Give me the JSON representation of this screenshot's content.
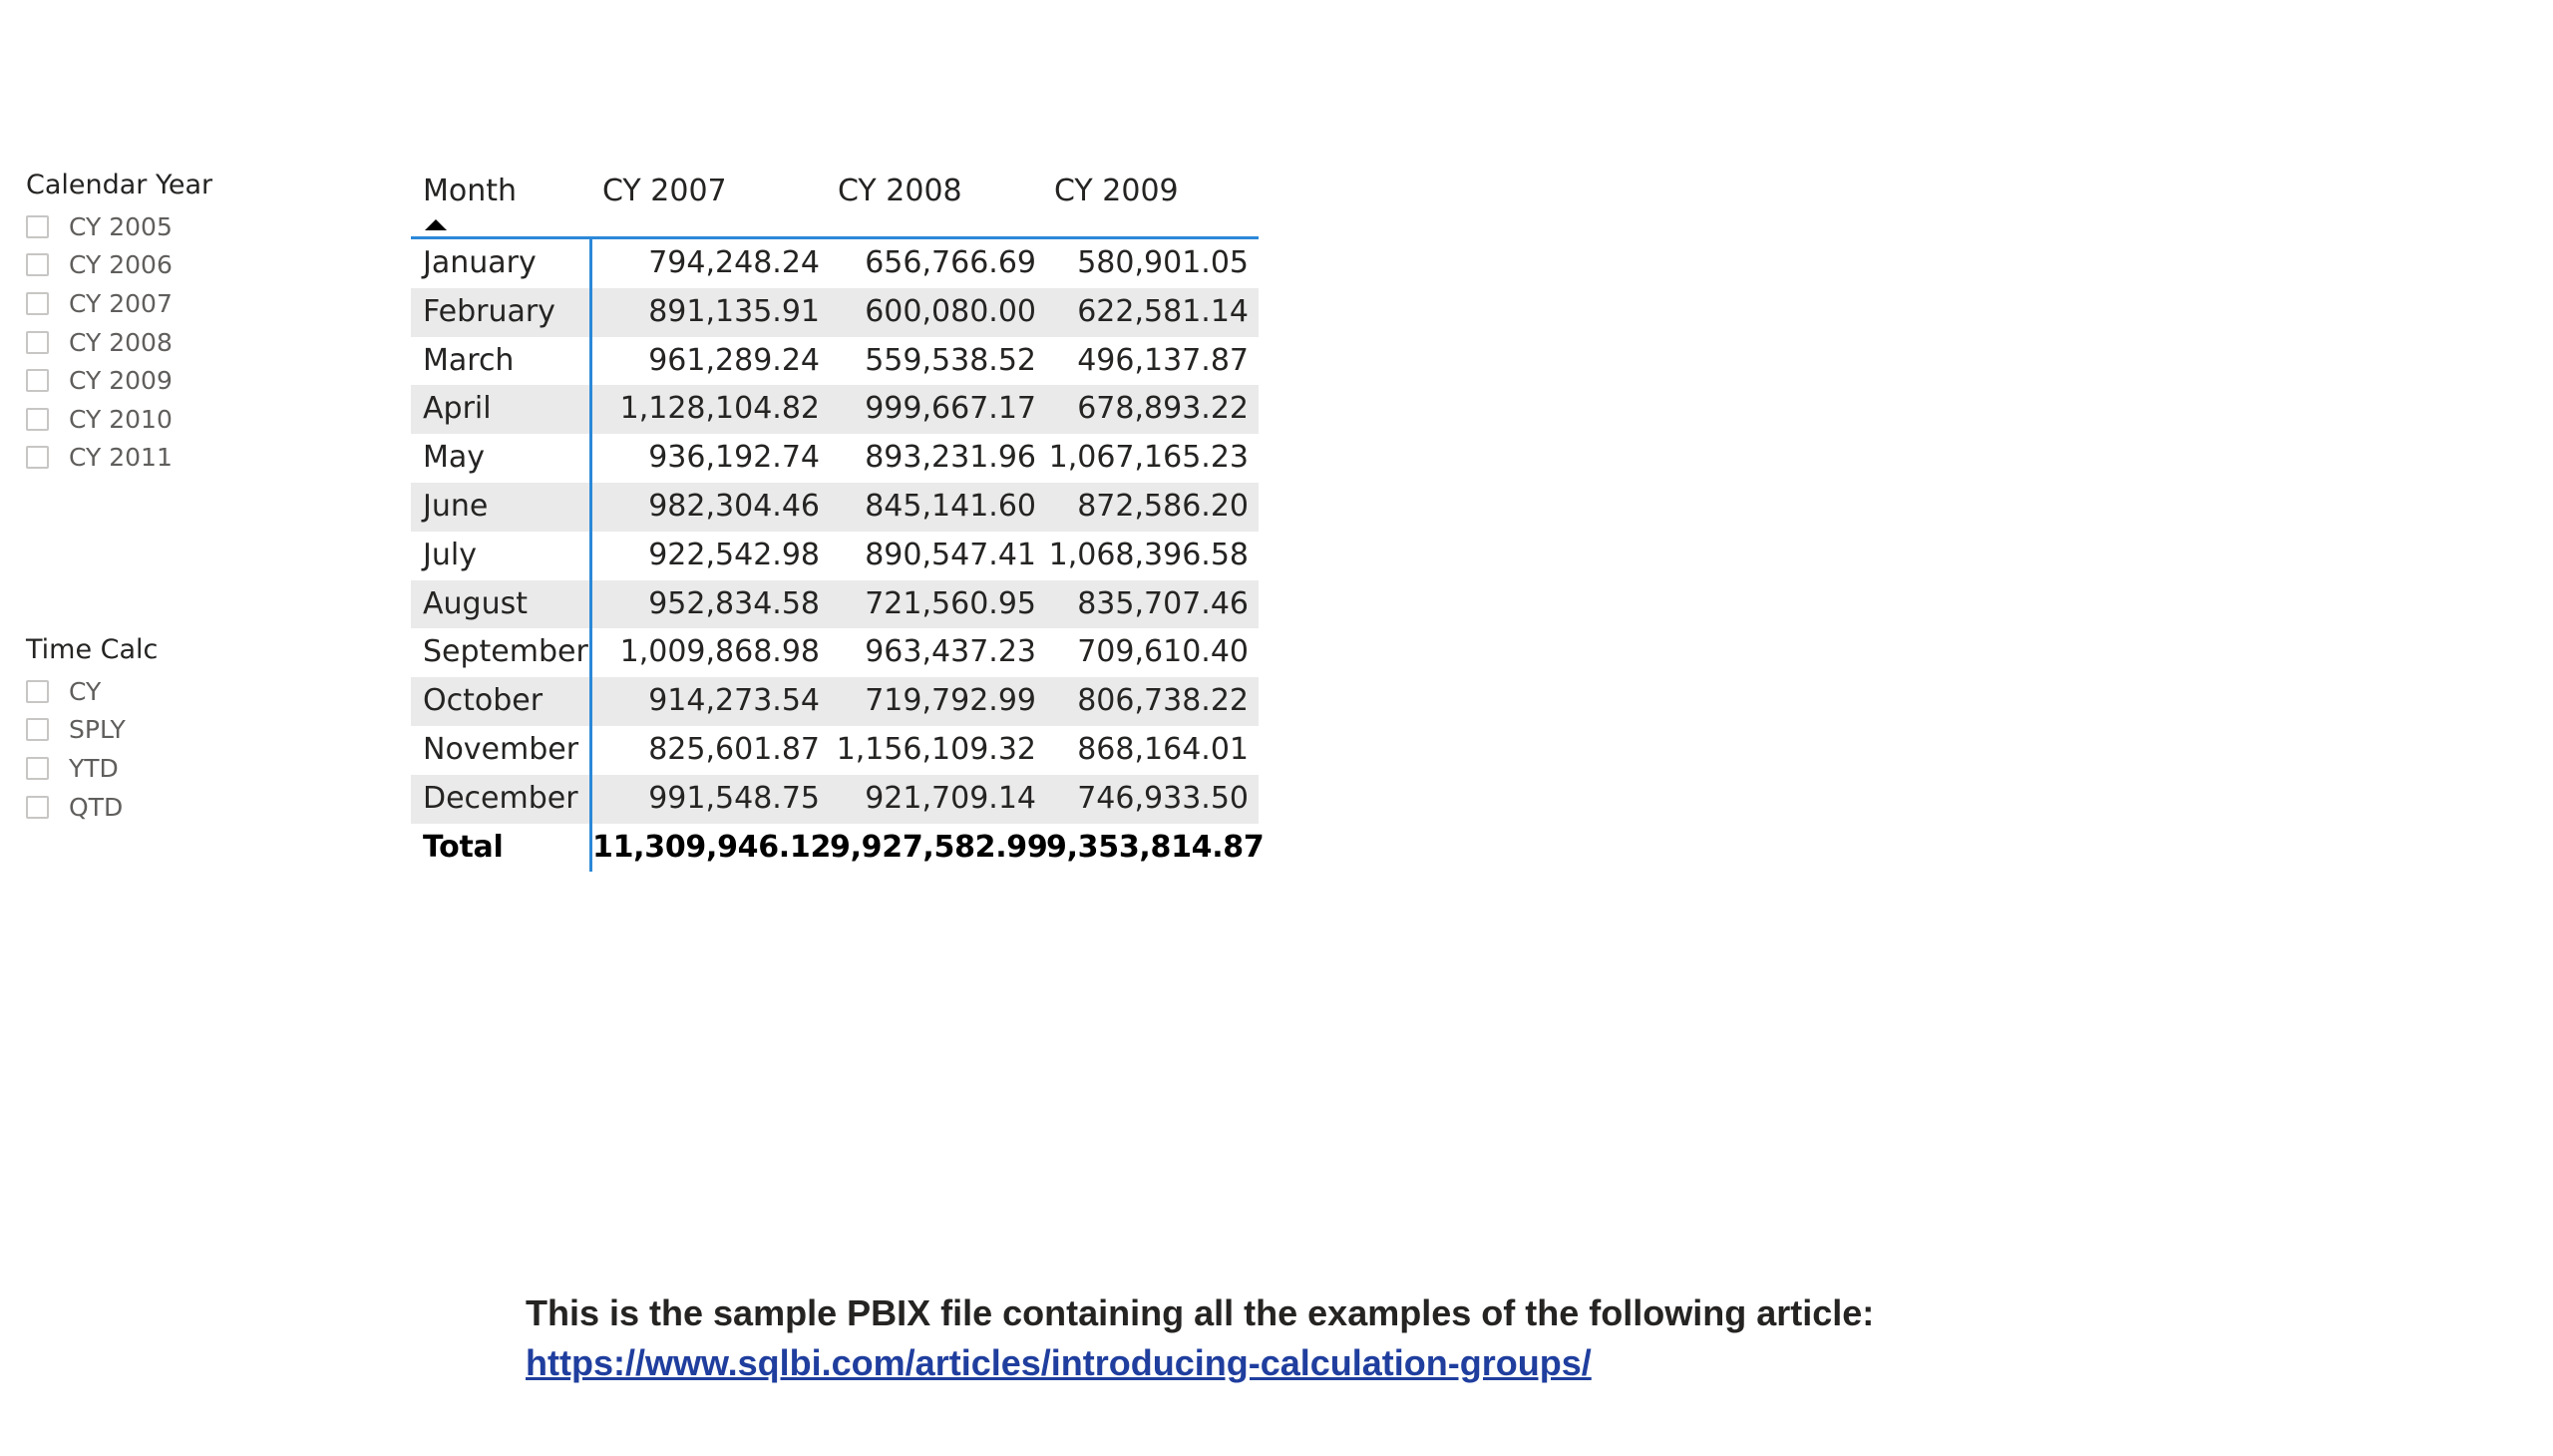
{
  "slicers": {
    "calendar_year": {
      "title": "Calendar Year",
      "items": [
        "CY 2005",
        "CY 2006",
        "CY 2007",
        "CY 2008",
        "CY 2009",
        "CY 2010",
        "CY 2011"
      ]
    },
    "time_calc": {
      "title": "Time Calc",
      "items": [
        "CY",
        "SPLY",
        "YTD",
        "QTD"
      ]
    }
  },
  "matrix": {
    "headers": [
      "Month",
      "CY 2007",
      "CY 2008",
      "CY 2009"
    ],
    "sort_indicator": "sort-ascending",
    "rows": [
      {
        "month": "January",
        "values": [
          "794,248.24",
          "656,766.69",
          "580,901.05"
        ]
      },
      {
        "month": "February",
        "values": [
          "891,135.91",
          "600,080.00",
          "622,581.14"
        ]
      },
      {
        "month": "March",
        "values": [
          "961,289.24",
          "559,538.52",
          "496,137.87"
        ]
      },
      {
        "month": "April",
        "values": [
          "1,128,104.82",
          "999,667.17",
          "678,893.22"
        ]
      },
      {
        "month": "May",
        "values": [
          "936,192.74",
          "893,231.96",
          "1,067,165.23"
        ]
      },
      {
        "month": "June",
        "values": [
          "982,304.46",
          "845,141.60",
          "872,586.20"
        ]
      },
      {
        "month": "July",
        "values": [
          "922,542.98",
          "890,547.41",
          "1,068,396.58"
        ]
      },
      {
        "month": "August",
        "values": [
          "952,834.58",
          "721,560.95",
          "835,707.46"
        ]
      },
      {
        "month": "September",
        "values": [
          "1,009,868.98",
          "963,437.23",
          "709,610.40"
        ]
      },
      {
        "month": "October",
        "values": [
          "914,273.54",
          "719,792.99",
          "806,738.22"
        ]
      },
      {
        "month": "November",
        "values": [
          "825,601.87",
          "1,156,109.32",
          "868,164.01"
        ]
      },
      {
        "month": "December",
        "values": [
          "991,548.75",
          "921,709.14",
          "746,933.50"
        ]
      }
    ],
    "total": {
      "label": "Total",
      "values": [
        "11,309,946.12",
        "9,927,582.99",
        "9,353,814.87"
      ]
    }
  },
  "note": {
    "text": "This is the sample PBIX file containing all the examples of the following article:",
    "link": "https://www.sqlbi.com/articles/introducing-calculation-groups/"
  },
  "colors": {
    "accent_blue": "#2b88d8",
    "link": "#1f3e9e",
    "row_alt": "#eaeaea"
  }
}
